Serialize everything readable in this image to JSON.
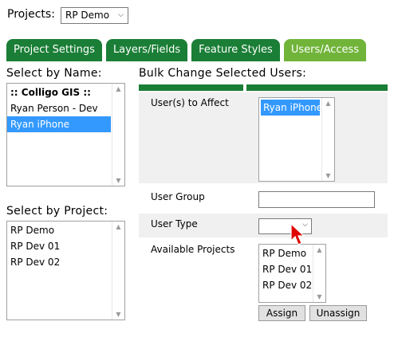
{
  "projects": {
    "label": "Projects:",
    "selected": "RP Demo"
  },
  "tabs": [
    {
      "label": "Project Settings",
      "active": false
    },
    {
      "label": "Layers/Fields",
      "active": false
    },
    {
      "label": "Feature Styles",
      "active": false
    },
    {
      "label": "Users/Access",
      "active": true
    }
  ],
  "select_by_name": {
    "label": "Select by Name:",
    "items": [
      ":: Colligo GIS ::",
      "Ryan Person - Dev",
      "Ryan iPhone"
    ],
    "selected": "Ryan iPhone"
  },
  "select_by_project": {
    "label": "Select by Project:",
    "items": [
      "RP Demo",
      "RP Dev 01",
      "RP Dev 02"
    ]
  },
  "bulk_change": {
    "title": "Bulk Change Selected Users:",
    "users_to_affect": {
      "label": "User(s) to Affect",
      "items": [
        "Ryan iPhone"
      ]
    },
    "user_group": {
      "label": "User Group",
      "value": ""
    },
    "user_type": {
      "label": "User Type",
      "value": ""
    },
    "available_projects": {
      "label": "Available Projects",
      "items": [
        "RP Demo",
        "RP Dev 01",
        "RP Dev 02"
      ]
    },
    "assign_label": "Assign",
    "unassign_label": "Unassign"
  },
  "colors": {
    "tab_green": "#1a7e36",
    "tab_active": "#71b43a",
    "selection_blue": "#3399ff",
    "cursor_red": "#e00000"
  }
}
